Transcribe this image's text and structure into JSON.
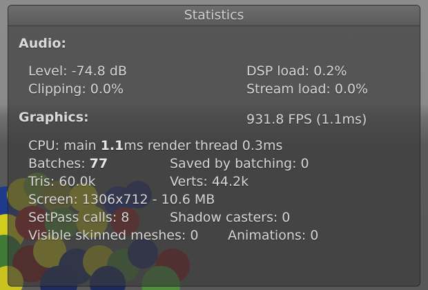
{
  "window": {
    "title": "Statistics"
  },
  "audio": {
    "heading": "Audio:",
    "level": "Level: -74.8 dB",
    "dsp_load": "DSP load: 0.2%",
    "clipping": "Clipping: 0.0%",
    "stream_load": "Stream load: 0.0%"
  },
  "graphics": {
    "heading": "Graphics:",
    "fps": "931.8 FPS (1.1ms)",
    "cpu_prefix": "CPU: main ",
    "cpu_main": "1.1",
    "cpu_suffix": "ms  render thread 0.3ms",
    "batches_prefix": "Batches: ",
    "batches_value": "77",
    "saved_by_batching": "Saved by batching: 0",
    "tris": "Tris: 60.0k",
    "verts": "Verts: 44.2k",
    "screen": "Screen: 1306x712 - 10.6 MB",
    "setpass": "SetPass calls: 8",
    "shadow_casters": "Shadow casters: 0",
    "skinned_meshes": "Visible skinned meshes: 0",
    "animations": "Animations: 0"
  },
  "colors": {
    "ball_yellow": "#c8c21c",
    "ball_green": "#4f8a3a",
    "ball_red": "#8e1f1f",
    "ball_blue": "#1c2e6e"
  }
}
